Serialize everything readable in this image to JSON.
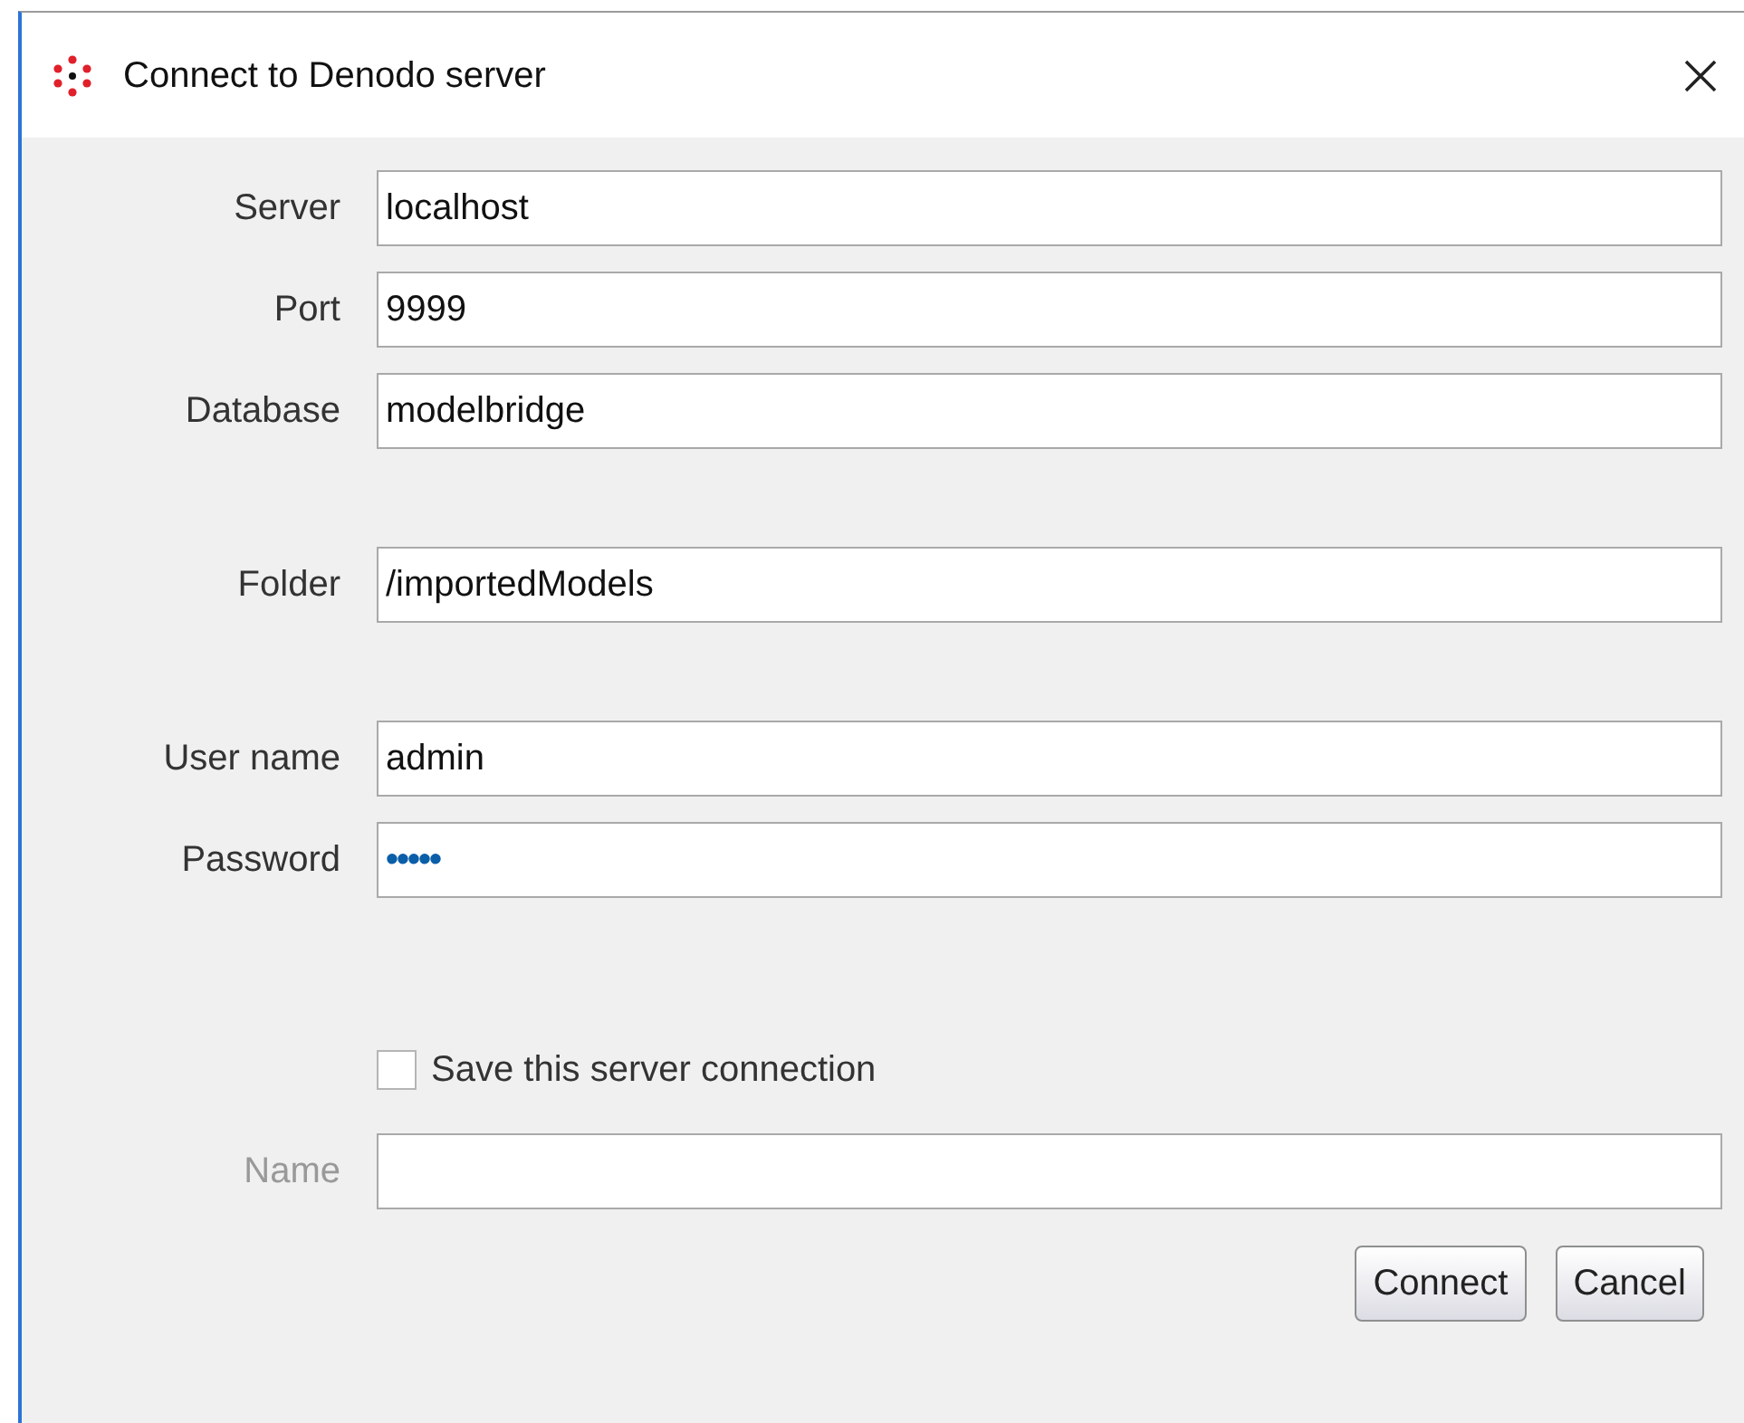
{
  "window": {
    "title": "Connect to Denodo server"
  },
  "field_groups": [
    [
      {
        "label": "Server",
        "value": "localhost",
        "kind": "text"
      },
      {
        "label": "Port",
        "value": "9999",
        "kind": "text"
      },
      {
        "label": "Database",
        "value": "modelbridge",
        "kind": "text"
      }
    ],
    [
      {
        "label": "Folder",
        "value": "/importedModels",
        "kind": "text"
      }
    ],
    [
      {
        "label": "User name",
        "value": "admin",
        "kind": "text"
      },
      {
        "label": "Password",
        "value": "•••••",
        "kind": "password"
      }
    ]
  ],
  "save_checkbox": {
    "label": "Save this server connection",
    "checked": false
  },
  "name_field": {
    "label": "Name",
    "disabled": true
  },
  "buttons": [
    "Connect",
    "Cancel"
  ]
}
